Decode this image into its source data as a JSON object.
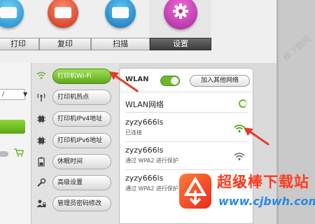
{
  "tabs": [
    {
      "label": "打印"
    },
    {
      "label": "复印"
    },
    {
      "label": "扫描"
    },
    {
      "label": "设置"
    }
  ],
  "active_tab": "设置",
  "left_panel": {
    "dropdown_value": "/",
    "dropdown_arrow": "▼"
  },
  "menu": {
    "items": [
      {
        "icon": "wifi-icon",
        "label": "打印机Wi-Fi",
        "active": true
      },
      {
        "icon": "hotspot-icon",
        "label": "打印机热点"
      },
      {
        "icon": "chip-icon",
        "label": "打印机IPv4地址"
      },
      {
        "icon": "chip-icon",
        "label": "打印机IPv6地址"
      },
      {
        "icon": "battery-icon",
        "label": "休眠时间"
      },
      {
        "icon": "wrench-icon",
        "label": "高级设置"
      },
      {
        "icon": "user-lock-icon",
        "label": "管理员密码修改"
      }
    ]
  },
  "wlan": {
    "title": "WLAN",
    "toggle_on": true,
    "add_network_label": "加入其他网络",
    "networks_title": "WLAN网络",
    "networks": [
      {
        "name": "zyzy666ls",
        "status": "已连接",
        "connected": true
      },
      {
        "name": "zyzy666ls",
        "status": "通过 WPA2 进行保护",
        "connected": false
      },
      {
        "name": "zyzy666ls",
        "status": "通过 WPA2 进行保护",
        "connected": false
      }
    ]
  },
  "colors": {
    "accent_green": "#6cb62b",
    "arrow_red": "#e23b2b",
    "settings_tab": "#4a4a4a"
  },
  "watermark": {
    "title": "超级棒下载站",
    "url": "www.cjbwh.com",
    "corner": "棒下载网"
  }
}
